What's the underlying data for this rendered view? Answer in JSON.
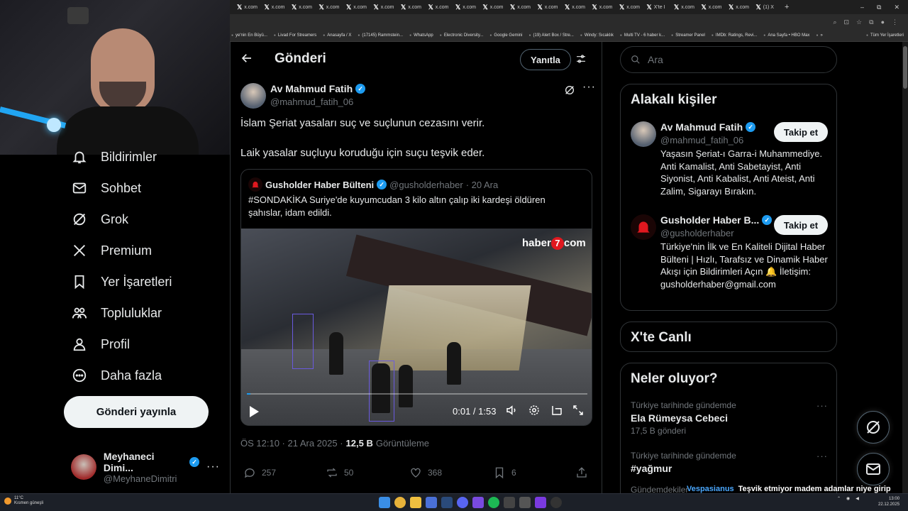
{
  "browser": {
    "tabs": [
      "x.com",
      "x.com",
      "x.com",
      "x.com",
      "x.com",
      "x.com",
      "x.com",
      "x.com",
      "x.com",
      "x.com",
      "x.com",
      "x.com",
      "x.com",
      "x.com",
      "x.com",
      "X'te I",
      "x.com",
      "x.com",
      "x.com",
      "(1) X"
    ],
    "new_tab": "+",
    "window_buttons": [
      "–",
      "⧉",
      "✕"
    ],
    "bookmarks": [
      "ye'nin En Büyü...",
      "Livad For Streamers",
      "Anasayfa / X",
      "(17145) Rammstein...",
      "WhatsApp",
      "Electronic Diversity...",
      "Google Gemini",
      "(19) Alert Box / Stre...",
      "Windy: Sıcaklık",
      "Multi TV - 6 haber k...",
      "Streamer Panel",
      "IMDb: Ratings, Revi...",
      "Ana Sayfa • HBO Max",
      "»",
      "Tüm Yer İşaretleri"
    ]
  },
  "nav": {
    "items": [
      {
        "label": "Bildirimler",
        "icon": "bell-icon"
      },
      {
        "label": "Sohbet",
        "icon": "mail-icon"
      },
      {
        "label": "Grok",
        "icon": "grok-icon"
      },
      {
        "label": "Premium",
        "icon": "x-logo-icon"
      },
      {
        "label": "Yer İşaretleri",
        "icon": "bookmark-icon"
      },
      {
        "label": "Topluluklar",
        "icon": "communities-icon"
      },
      {
        "label": "Profil",
        "icon": "profile-icon"
      },
      {
        "label": "Daha fazla",
        "icon": "more-circle-icon"
      }
    ],
    "post_button": "Gönderi yayınla",
    "account": {
      "name": "Meyhaneci Dimi...",
      "handle": "@MeyhaneDimitri",
      "more": "···"
    }
  },
  "main": {
    "title": "Gönderi",
    "reply_button": "Yanıtla",
    "tweet": {
      "author_name": "Av Mahmud Fatih",
      "author_handle": "@mahmud_fatih_06",
      "more": "···",
      "text_line1": "İslam Şeriat yasaları suç ve suçlunun cezasını verir.",
      "text_line2": "Laik yasalar suçluyu koruduğu için suçu teşvik eder.",
      "quote": {
        "author_name": "Gusholder Haber Bülteni",
        "author_handle": "@gusholderhaber",
        "date": "· 20 Ara",
        "text": "#SONDAKİKA Suriye'de kuyumcudan 3 kilo altın çalıp iki kardeşi öldüren şahıslar, idam edildi.",
        "video": {
          "logo_text": "haber",
          "logo_badge": "7",
          "logo_suffix": "com",
          "time": "0:01 / 1:53",
          "progress": 0.01
        }
      },
      "timestamp": "ÖS 12:10 · 21 Ara 2025 ·",
      "views": "12,5 B",
      "views_label": "Görüntüleme",
      "replies": "257",
      "reposts": "50",
      "likes": "368",
      "bookmarks": "6"
    }
  },
  "right": {
    "search_placeholder": "Ara",
    "related_title": "Alakalı kişiler",
    "people": [
      {
        "name": "Av Mahmud Fatih",
        "handle": "@mahmud_fatih_06",
        "follow": "Takip et",
        "bio": "Yaşasın Şeriat-ı Garra-i Muhammediye. Anti Kamalist, Anti Sabetayist, Anti Siyonist, Anti Kabalist, Anti Ateist, Anti Zalim, Sigarayı Bırakın."
      },
      {
        "name": "Gusholder Haber B...",
        "handle": "@gusholderhaber",
        "follow": "Takip et",
        "bio": "Türkiye'nin İlk ve En Kaliteli Dijital Haber Bülteni | Hızlı, Tarafsız ve Dinamik Haber Akışı için Bildirimleri Açın 🔔 İletişim: gusholderhaber@gmail.com"
      }
    ],
    "live_title": "X'te Canlı",
    "trends_title": "Neler oluyor?",
    "trends": [
      {
        "context": "Türkiye tarihinde gündemde",
        "name": "Ela Rümeysa Cebeci",
        "count": "17,5 B gönderi"
      },
      {
        "context": "Türkiye tarihinde gündemde",
        "name": "#yağmur",
        "count": ""
      }
    ],
    "trend_more": "···",
    "partial_trend_context": "Gündemdekiler"
  },
  "overlay": {
    "chat_user": "Vespasianus",
    "chat_message": "Teşvik etmiyor madem adamlar niye girip soyuyorlar"
  },
  "taskbar": {
    "weather_temp": "11°C",
    "weather_desc": "Kısmen güneşli",
    "time": "13:00",
    "date": "22.12.2025"
  },
  "colors": {
    "accent": "#1d9bf0",
    "background": "#000000",
    "border": "#2f3336",
    "muted": "#71767b"
  }
}
